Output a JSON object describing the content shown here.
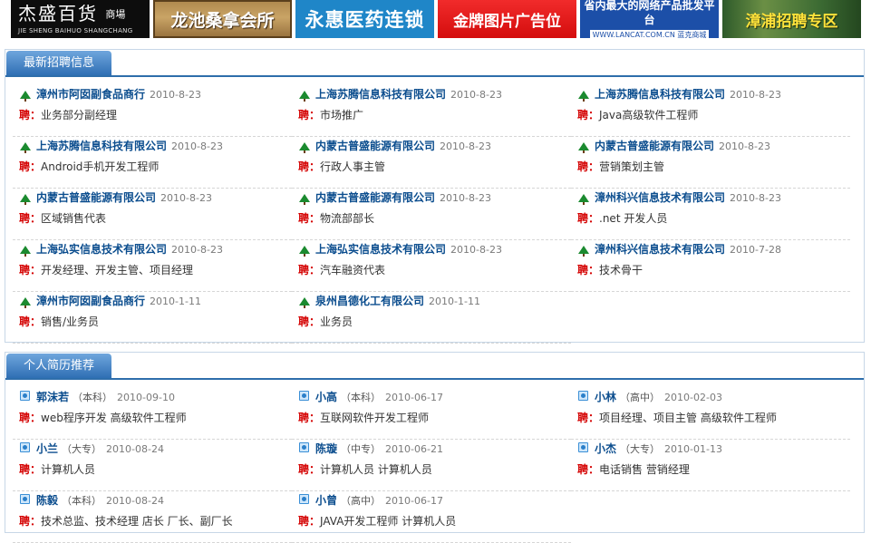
{
  "banners": [
    {
      "main": "杰盛百货",
      "suffix": "商場",
      "sub": "JIE SHENG BAIHUO SHANGCHANG"
    },
    {
      "main": "龙池桑拿会所"
    },
    {
      "main": "永惠医药连锁"
    },
    {
      "main": "金牌图片广告位"
    },
    {
      "main": "省内最大的网络产品批发平台",
      "sub": "WWW.LANCAT.COM.CN  蓝克商城"
    },
    {
      "main": "漳浦招聘专区"
    }
  ],
  "jobs": {
    "title": "最新招聘信息",
    "pin_label": "聘：",
    "items": [
      {
        "company": "漳州市阿囡副食品商行",
        "date": "2010-8-23",
        "position": "业务部分副经理"
      },
      {
        "company": "上海苏腾信息科技有限公司",
        "date": "2010-8-23",
        "position": "市场推广"
      },
      {
        "company": "上海苏腾信息科技有限公司",
        "date": "2010-8-23",
        "position": "Java高级软件工程师"
      },
      {
        "company": "上海苏腾信息科技有限公司",
        "date": "2010-8-23",
        "position": "Android手机开发工程师"
      },
      {
        "company": "内蒙古普盛能源有限公司",
        "date": "2010-8-23",
        "position": "行政人事主管"
      },
      {
        "company": "内蒙古普盛能源有限公司",
        "date": "2010-8-23",
        "position": "营销策划主管"
      },
      {
        "company": "内蒙古普盛能源有限公司",
        "date": "2010-8-23",
        "position": "区域销售代表"
      },
      {
        "company": "内蒙古普盛能源有限公司",
        "date": "2010-8-23",
        "position": "物流部部长"
      },
      {
        "company": "漳州科兴信息技术有限公司",
        "date": "2010-8-23",
        "position": ".net 开发人员"
      },
      {
        "company": "上海弘实信息技术有限公司",
        "date": "2010-8-23",
        "position": "开发经理、开发主管、项目经理"
      },
      {
        "company": "上海弘实信息技术有限公司",
        "date": "2010-8-23",
        "position": "汽车融资代表"
      },
      {
        "company": "漳州科兴信息技术有限公司",
        "date": "2010-7-28",
        "position": "技术骨干"
      },
      {
        "company": "漳州市阿囡副食品商行",
        "date": "2010-1-11",
        "position": "销售/业务员"
      },
      {
        "company": "泉州昌德化工有限公司",
        "date": "2010-1-11",
        "position": "业务员"
      }
    ]
  },
  "resumes": {
    "title": "个人简历推荐",
    "pin_label": "聘：",
    "items": [
      {
        "name": "郭沫若",
        "edu": "（本科）",
        "date": "2010-09-10",
        "position": "web程序开发 高级软件工程师"
      },
      {
        "name": "小高",
        "edu": "（本科）",
        "date": "2010-06-17",
        "position": "互联网软件开发工程师"
      },
      {
        "name": "小林",
        "edu": "（高中）",
        "date": "2010-02-03",
        "position": "项目经理、项目主管 高级软件工程师"
      },
      {
        "name": "小兰",
        "edu": "（大专）",
        "date": "2010-08-24",
        "position": "计算机人员"
      },
      {
        "name": "陈璇",
        "edu": "（中专）",
        "date": "2010-06-21",
        "position": "计算机人员 计算机人员"
      },
      {
        "name": "小杰",
        "edu": "（大专）",
        "date": "2010-01-13",
        "position": "电话销售 营销经理"
      },
      {
        "name": "陈毅",
        "edu": "（本科）",
        "date": "2010-08-24",
        "position": "技术总监、技术经理 店长 厂长、副厂长"
      },
      {
        "name": "小曾",
        "edu": "（高中）",
        "date": "2010-06-17",
        "position": "JAVA开发工程师 计算机人员"
      }
    ]
  }
}
